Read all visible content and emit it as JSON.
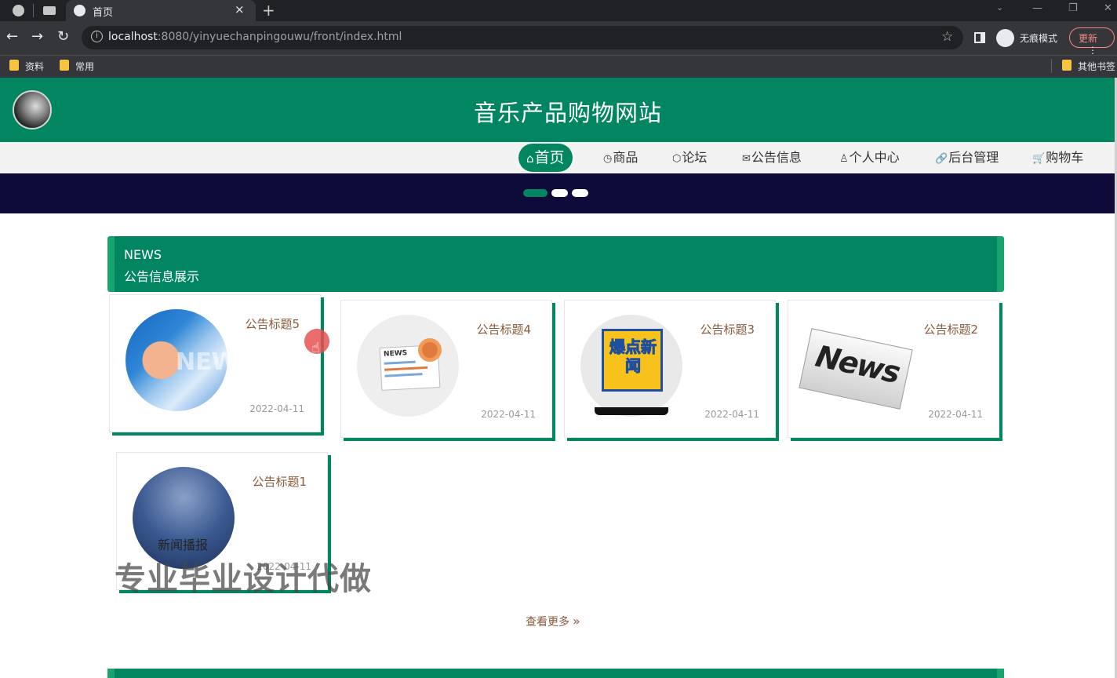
{
  "browser": {
    "tab_title": "首页",
    "tab_close": "×",
    "new_tab": "+",
    "url_host": "localhost",
    "url_rest": ":8080/yinyuechanpingouwu/front/index.html",
    "incognito_label": "无痕模式",
    "update_label": "更新",
    "nav_back": "←",
    "nav_forward": "→",
    "nav_reload": "↻",
    "star": "☆",
    "win_minimize": "—",
    "win_restore": "❐",
    "win_close": "✕",
    "bookmarks": [
      "资料",
      "常用",
      "其他书签"
    ]
  },
  "site": {
    "title": "音乐产品购物网站",
    "nav": [
      {
        "icon": "⌂",
        "label": "首页",
        "active": true
      },
      {
        "icon": "◷",
        "label": "商品"
      },
      {
        "icon": "⬡",
        "label": "论坛"
      },
      {
        "icon": "✉",
        "label": "公告信息"
      },
      {
        "icon": "♙",
        "label": "个人中心"
      },
      {
        "icon": "🔗",
        "label": "后台管理"
      },
      {
        "icon": "🛒",
        "label": "购物车"
      }
    ],
    "carousel_active_index": 0
  },
  "news_section": {
    "title_en": "NEWS",
    "title_cn": "公告信息展示",
    "cards": [
      {
        "title": "公告标题5",
        "date": "2022-04-11",
        "image": "globe-news-image"
      },
      {
        "title": "公告标题4",
        "date": "2022-04-11",
        "image": "newspaper-camera-image"
      },
      {
        "title": "公告标题3",
        "date": "2022-04-11",
        "image": "breaking-news-tv-image",
        "image_text": "爆点新闻"
      },
      {
        "title": "公告标题2",
        "date": "2022-04-11",
        "image": "news-paper-image",
        "image_text": "News"
      },
      {
        "title": "公告标题1",
        "date": "2022-04-11",
        "image": "news-broadcast-image",
        "image_text": "新闻播报"
      }
    ],
    "img5_text": "NEW",
    "img4_text": "NEWS",
    "more_label": "查看更多",
    "more_icon": "»"
  },
  "watermark": "专业毕业设计代做",
  "colors": {
    "primary": "#028661",
    "banner": "#0e0b38",
    "card_title": "#8a5a3b"
  }
}
